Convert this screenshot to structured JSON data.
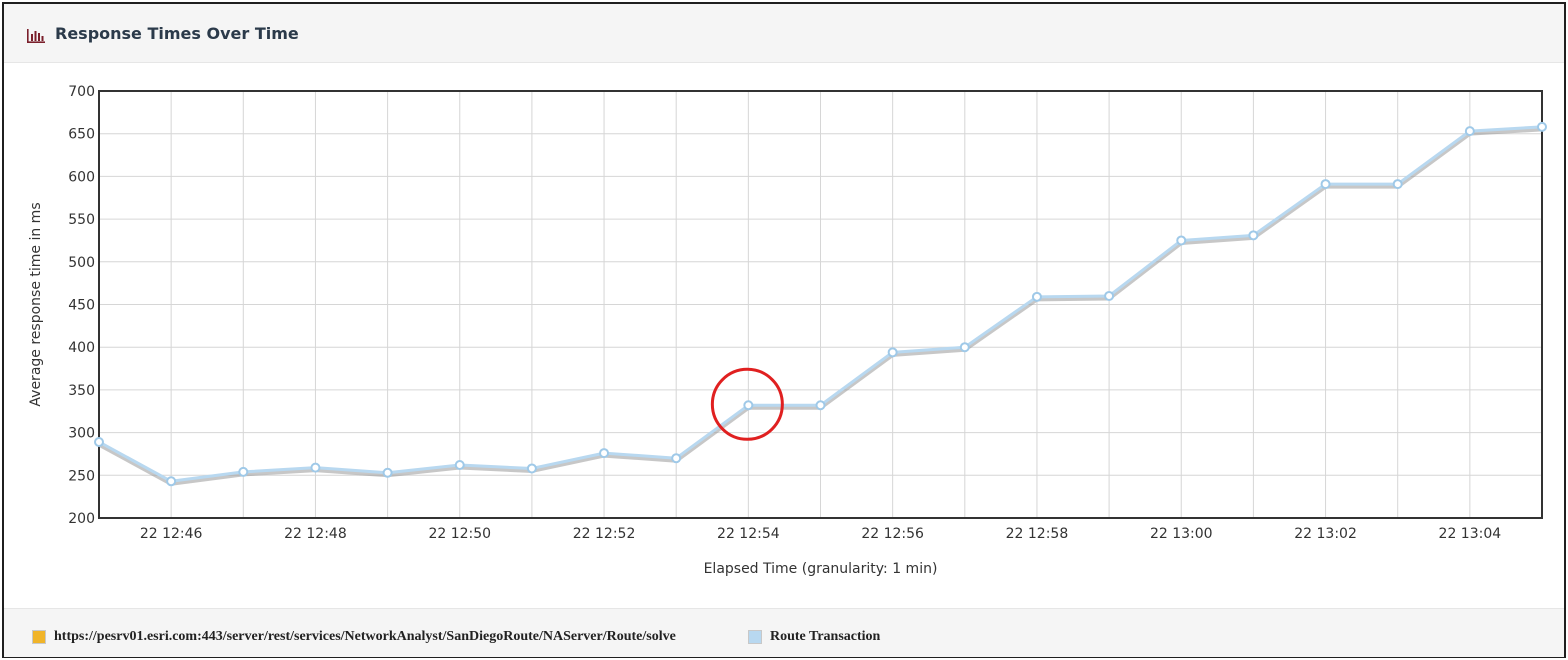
{
  "panel": {
    "title": "Response Times Over Time",
    "icon": "bar-chart-icon"
  },
  "chart_data": {
    "type": "line",
    "title": "",
    "xlabel": "Elapsed Time (granularity: 1 min)",
    "ylabel": "Average response time in ms",
    "ylim": [
      200,
      700
    ],
    "yticks": [
      200,
      250,
      300,
      350,
      400,
      450,
      500,
      550,
      600,
      650,
      700
    ],
    "x": [
      "22 12:45",
      "22 12:46",
      "22 12:47",
      "22 12:48",
      "22 12:49",
      "22 12:50",
      "22 12:51",
      "22 12:52",
      "22 12:53",
      "22 12:54",
      "22 12:55",
      "22 12:56",
      "22 12:57",
      "22 12:58",
      "22 12:59",
      "22 13:00",
      "22 13:01",
      "22 13:02",
      "22 13:03",
      "22 13:04",
      "22 13:05"
    ],
    "xtick_labels": [
      "22 12:46",
      "22 12:48",
      "22 12:50",
      "22 12:52",
      "22 12:54",
      "22 12:56",
      "22 12:58",
      "22 13:00",
      "22 13:02",
      "22 13:04"
    ],
    "series": [
      {
        "name": "Route Transaction",
        "color": "#b8d8f0",
        "values": [
          289,
          243,
          254,
          259,
          253,
          262,
          258,
          276,
          270,
          332,
          332,
          394,
          400,
          459,
          460,
          525,
          531,
          591,
          591,
          653,
          658
        ]
      }
    ],
    "grid": true,
    "legend_position": "bottom",
    "annotations": [
      {
        "type": "circle",
        "color": "#e02020",
        "at_x": "22 12:54",
        "at_y": 332
      }
    ]
  },
  "legend": [
    {
      "label": "https://pesrv01.esri.com:443/server/rest/services/NetworkAnalyst/SanDiegoRoute/NAServer/Route/solve",
      "color": "#f0b429"
    },
    {
      "label": "Route Transaction",
      "color": "#b8d8f0"
    }
  ]
}
